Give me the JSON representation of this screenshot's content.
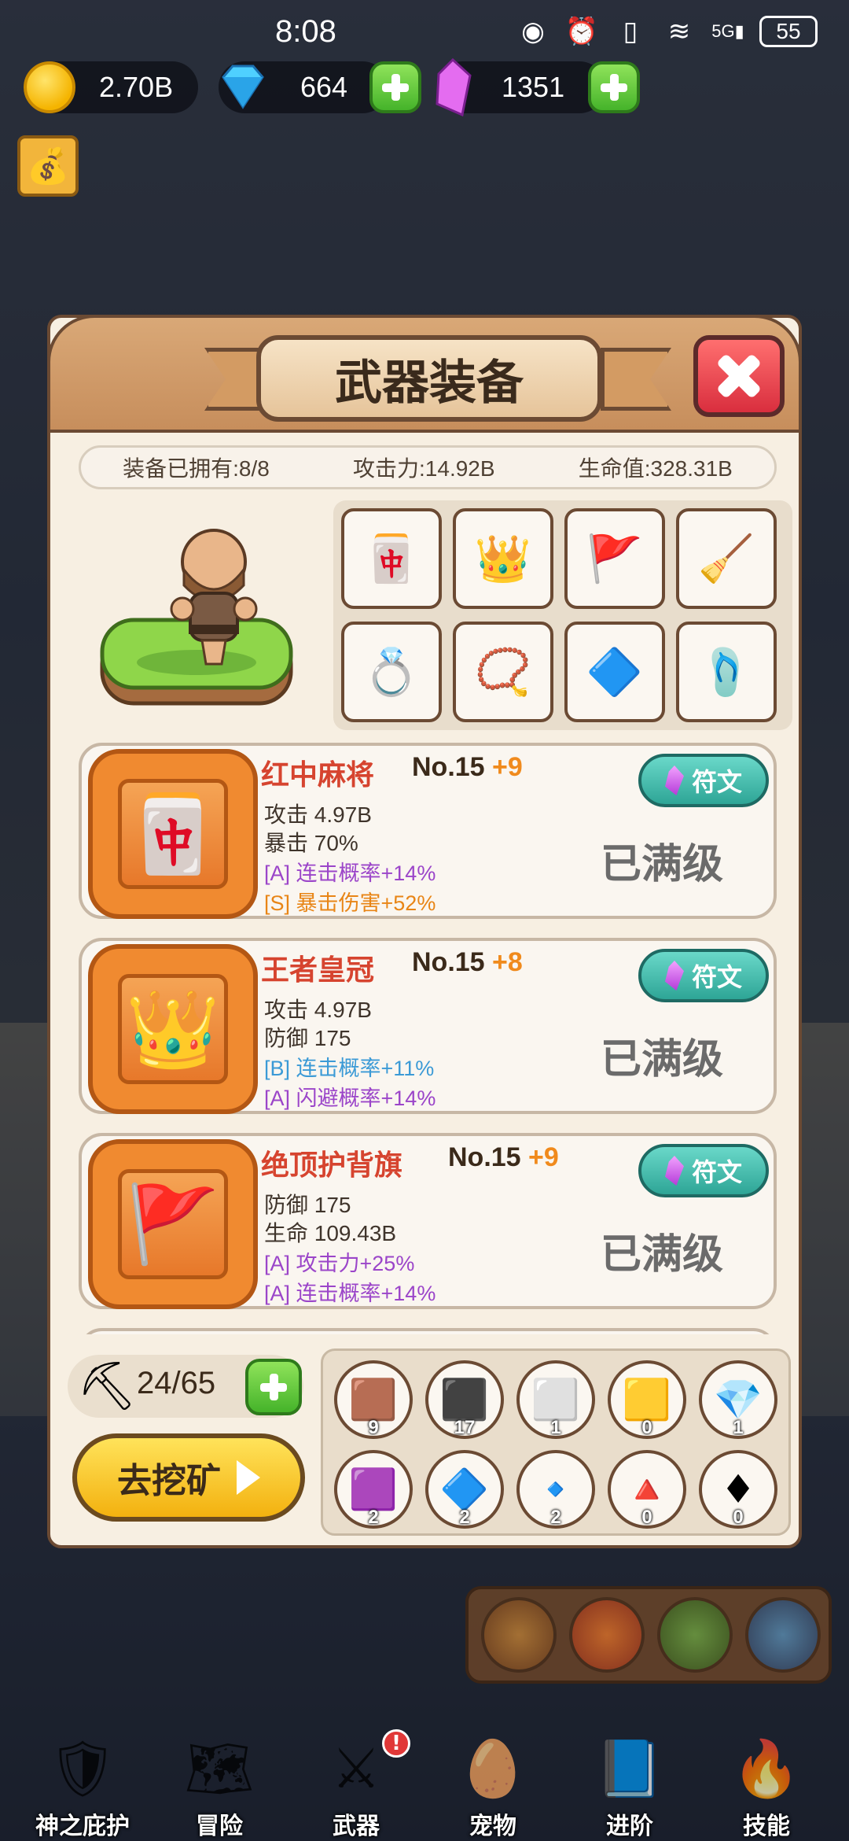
{
  "status_bar": {
    "time": "8:08",
    "network": "5G",
    "battery": "55"
  },
  "currency": {
    "gold": "2.70B",
    "diamond": "664",
    "crystal": "1351"
  },
  "modal": {
    "title": "武器装备",
    "stats": {
      "owned": "装备已拥有:8/8",
      "attack": "攻击力:14.92B",
      "hp": "生命值:328.31B"
    },
    "slots": [
      {
        "icon": "mahjong-tiles-icon",
        "glyph": "🀄"
      },
      {
        "icon": "crown-icon",
        "glyph": "👑"
      },
      {
        "icon": "banner-flags-icon",
        "glyph": "🚩"
      },
      {
        "icon": "broom-icon",
        "glyph": "🧹"
      },
      {
        "icon": "vine-ring-icon",
        "glyph": "💍"
      },
      {
        "icon": "amulet-icon",
        "glyph": "📿"
      },
      {
        "icon": "gem-stone-icon",
        "glyph": "🔷"
      },
      {
        "icon": "slipper-icon",
        "glyph": "🩴"
      }
    ],
    "equipment": [
      {
        "name": "红中麻将",
        "no": "No.15",
        "plus": "+9",
        "l1": "攻击 4.97B",
        "l2": "暴击 70%",
        "l3": "[A] 连击概率+14%",
        "l3_color": "purple",
        "l4": "[S] 暴击伤害+52%",
        "l4_color": "orange",
        "rune": "符文",
        "status": "已满级",
        "glyph": "🀄"
      },
      {
        "name": "王者皇冠",
        "no": "No.15",
        "plus": "+8",
        "l1": "攻击 4.97B",
        "l2": "防御 175",
        "l3": "[B] 连击概率+11%",
        "l3_color": "blue",
        "l4": "[A] 闪避概率+14%",
        "l4_color": "purple",
        "rune": "符文",
        "status": "已满级",
        "glyph": "👑"
      },
      {
        "name": "绝顶护背旗",
        "no": "No.15",
        "plus": "+9",
        "l1": "防御 175",
        "l2": "生命 109.43B",
        "l3": "[A] 攻击力+25%",
        "l3_color": "purple",
        "l4": "[A] 连击概率+14%",
        "l4_color": "purple",
        "rune": "符文",
        "status": "已满级",
        "glyph": "🚩"
      }
    ],
    "pickaxe": {
      "count": "24/65"
    },
    "mine_button": "去挖矿",
    "ores": [
      {
        "icon": "copper-ore-icon",
        "glyph": "🟫",
        "count": "9"
      },
      {
        "icon": "coal-ore-icon",
        "glyph": "⬛",
        "count": "17"
      },
      {
        "icon": "silver-ore-icon",
        "glyph": "⬜",
        "count": "1"
      },
      {
        "icon": "gold-bar-icon",
        "glyph": "🟨",
        "count": "0"
      },
      {
        "icon": "diamond-crystal-icon",
        "glyph": "💎",
        "count": "1"
      },
      {
        "icon": "amethyst-icon",
        "glyph": "🟪",
        "count": "2"
      },
      {
        "icon": "sapphire-icon",
        "glyph": "🔷",
        "count": "2"
      },
      {
        "icon": "dark-crystal-icon",
        "glyph": "🔹",
        "count": "2"
      },
      {
        "icon": "ruby-cluster-icon",
        "glyph": "🔺",
        "count": "0"
      },
      {
        "icon": "dark-ruby-icon",
        "glyph": "♦",
        "count": "0"
      }
    ]
  },
  "nav": [
    {
      "label": "神之庇护",
      "icon": "angel-shield-icon",
      "glyph": "🛡"
    },
    {
      "label": "冒险",
      "icon": "map-scroll-icon",
      "glyph": "🗺"
    },
    {
      "label": "武器",
      "icon": "weapon-icon",
      "glyph": "⚔",
      "badge": "!"
    },
    {
      "label": "宠物",
      "icon": "pet-egg-icon",
      "glyph": "🥚"
    },
    {
      "label": "进阶",
      "icon": "book-icon",
      "glyph": "📘"
    },
    {
      "label": "技能",
      "icon": "fire-icon",
      "glyph": "🔥"
    }
  ],
  "colors": {
    "accent_purple": "#9b45c9",
    "accent_blue": "#3b9ad6",
    "accent_orange": "#e88516",
    "name_red": "#d6442f"
  }
}
